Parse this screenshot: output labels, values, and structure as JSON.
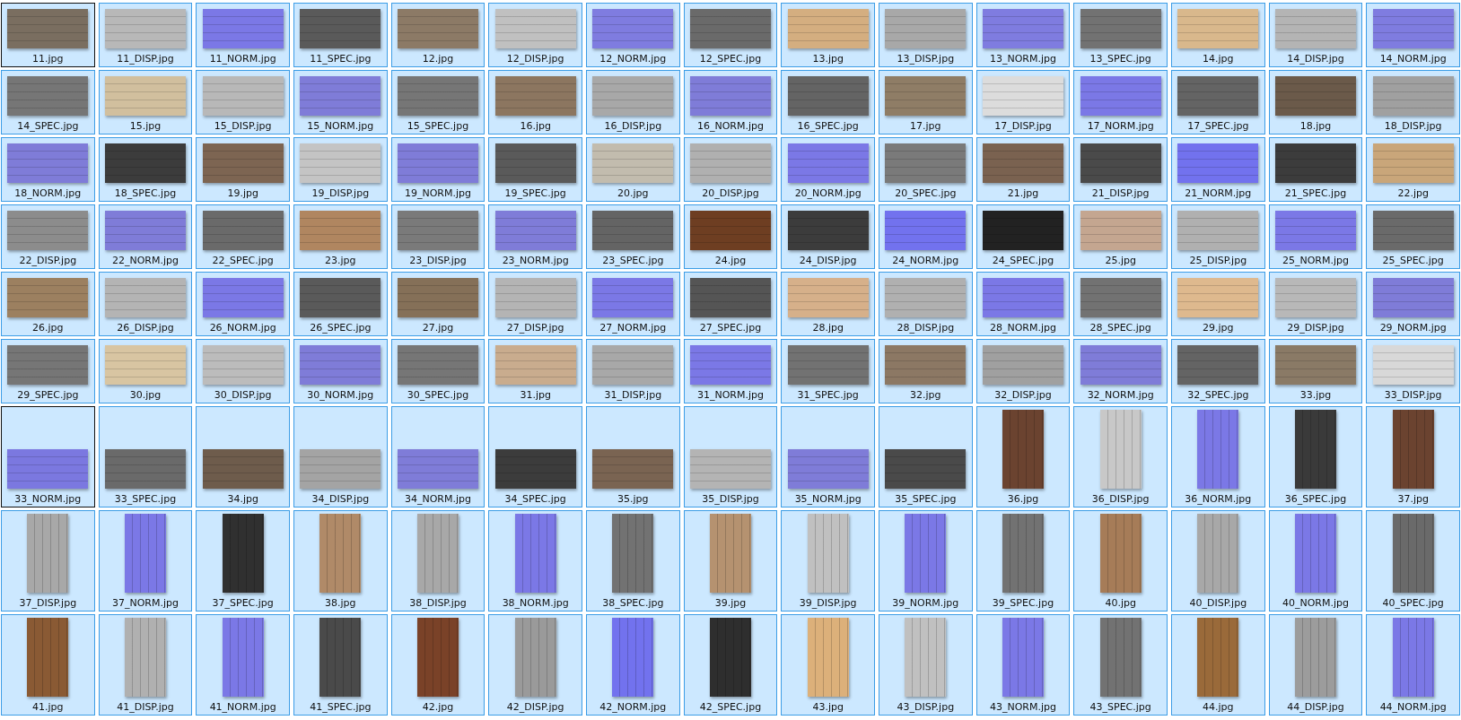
{
  "items": [
    {
      "name": "11.jpg",
      "kind": "landscape",
      "color": "#7a6e60",
      "selected": true,
      "focused": true
    },
    {
      "name": "11_DISP.jpg",
      "kind": "landscape",
      "color": "#b8b8b8",
      "selected": true,
      "focused": false
    },
    {
      "name": "11_NORM.jpg",
      "kind": "landscape",
      "color": "#7b78e6",
      "selected": true,
      "focused": false
    },
    {
      "name": "11_SPEC.jpg",
      "kind": "landscape",
      "color": "#5a5a5a",
      "selected": true,
      "focused": false
    },
    {
      "name": "12.jpg",
      "kind": "landscape",
      "color": "#8c7a66",
      "selected": true,
      "focused": false
    },
    {
      "name": "12_DISP.jpg",
      "kind": "landscape",
      "color": "#c0c0c0",
      "selected": true,
      "focused": false
    },
    {
      "name": "12_NORM.jpg",
      "kind": "landscape",
      "color": "#7f7ce0",
      "selected": true,
      "focused": false
    },
    {
      "name": "12_SPEC.jpg",
      "kind": "landscape",
      "color": "#6a6a6a",
      "selected": true,
      "focused": false
    },
    {
      "name": "13.jpg",
      "kind": "landscape",
      "color": "#d4ae80",
      "selected": true,
      "focused": false
    },
    {
      "name": "13_DISP.jpg",
      "kind": "landscape",
      "color": "#a8a8a8",
      "selected": true,
      "focused": false
    },
    {
      "name": "13_NORM.jpg",
      "kind": "landscape",
      "color": "#7f7ce0",
      "selected": true,
      "focused": false
    },
    {
      "name": "13_SPEC.jpg",
      "kind": "landscape",
      "color": "#727272",
      "selected": true,
      "focused": false
    },
    {
      "name": "14.jpg",
      "kind": "landscape",
      "color": "#d9b88c",
      "selected": true,
      "focused": false
    },
    {
      "name": "14_DISP.jpg",
      "kind": "landscape",
      "color": "#b4b4b4",
      "selected": true,
      "focused": false
    },
    {
      "name": "14_NORM.jpg",
      "kind": "landscape",
      "color": "#7f7ce0",
      "selected": true,
      "focused": false
    },
    {
      "name": "14_SPEC.jpg",
      "kind": "landscape",
      "color": "#767676",
      "selected": true,
      "focused": false
    },
    {
      "name": "15.jpg",
      "kind": "landscape",
      "color": "#d1bf9e",
      "selected": true,
      "focused": false
    },
    {
      "name": "15_DISP.jpg",
      "kind": "landscape",
      "color": "#b8b8b8",
      "selected": true,
      "focused": false
    },
    {
      "name": "15_NORM.jpg",
      "kind": "landscape",
      "color": "#7f7cd8",
      "selected": true,
      "focused": false
    },
    {
      "name": "15_SPEC.jpg",
      "kind": "landscape",
      "color": "#767676",
      "selected": true,
      "focused": false
    },
    {
      "name": "16.jpg",
      "kind": "landscape",
      "color": "#8c7660",
      "selected": true,
      "focused": false
    },
    {
      "name": "16_DISP.jpg",
      "kind": "landscape",
      "color": "#a8a8a8",
      "selected": true,
      "focused": false
    },
    {
      "name": "16_NORM.jpg",
      "kind": "landscape",
      "color": "#7f7cd8",
      "selected": true,
      "focused": false
    },
    {
      "name": "16_SPEC.jpg",
      "kind": "landscape",
      "color": "#646464",
      "selected": true,
      "focused": false
    },
    {
      "name": "17.jpg",
      "kind": "landscape",
      "color": "#8f7d66",
      "selected": true,
      "focused": false
    },
    {
      "name": "17_DISP.jpg",
      "kind": "landscape",
      "color": "#dcdcdc",
      "selected": true,
      "focused": false
    },
    {
      "name": "17_NORM.jpg",
      "kind": "landscape",
      "color": "#7b78e6",
      "selected": true,
      "focused": false
    },
    {
      "name": "17_SPEC.jpg",
      "kind": "landscape",
      "color": "#646464",
      "selected": true,
      "focused": false
    },
    {
      "name": "18.jpg",
      "kind": "landscape",
      "color": "#6b5a4a",
      "selected": true,
      "focused": false
    },
    {
      "name": "18_DISP.jpg",
      "kind": "landscape",
      "color": "#a0a0a0",
      "selected": true,
      "focused": false
    },
    {
      "name": "18_NORM.jpg",
      "kind": "landscape",
      "color": "#7f7cd8",
      "selected": true,
      "focused": false
    },
    {
      "name": "18_SPEC.jpg",
      "kind": "landscape",
      "color": "#3c3c3c",
      "selected": true,
      "focused": false
    },
    {
      "name": "19.jpg",
      "kind": "landscape",
      "color": "#7d6552",
      "selected": true,
      "focused": false
    },
    {
      "name": "19_DISP.jpg",
      "kind": "landscape",
      "color": "#c4c4c4",
      "selected": true,
      "focused": false
    },
    {
      "name": "19_NORM.jpg",
      "kind": "landscape",
      "color": "#7f7cd8",
      "selected": true,
      "focused": false
    },
    {
      "name": "19_SPEC.jpg",
      "kind": "landscape",
      "color": "#5a5a5a",
      "selected": true,
      "focused": false
    },
    {
      "name": "20.jpg",
      "kind": "landscape",
      "color": "#c2bcae",
      "selected": true,
      "focused": false
    },
    {
      "name": "20_DISP.jpg",
      "kind": "landscape",
      "color": "#b0b0b0",
      "selected": true,
      "focused": false
    },
    {
      "name": "20_NORM.jpg",
      "kind": "landscape",
      "color": "#7b78e6",
      "selected": true,
      "focused": false
    },
    {
      "name": "20_SPEC.jpg",
      "kind": "landscape",
      "color": "#7a7a7a",
      "selected": true,
      "focused": false
    },
    {
      "name": "21.jpg",
      "kind": "landscape",
      "color": "#7a6250",
      "selected": true,
      "focused": false
    },
    {
      "name": "21_DISP.jpg",
      "kind": "landscape",
      "color": "#4a4a4a",
      "selected": true,
      "focused": false
    },
    {
      "name": "21_NORM.jpg",
      "kind": "landscape",
      "color": "#7272ee",
      "selected": true,
      "focused": false
    },
    {
      "name": "21_SPEC.jpg",
      "kind": "landscape",
      "color": "#3c3c3c",
      "selected": true,
      "focused": false
    },
    {
      "name": "22.jpg",
      "kind": "landscape",
      "color": "#c9a67a",
      "selected": true,
      "focused": false
    },
    {
      "name": "22_DISP.jpg",
      "kind": "landscape",
      "color": "#8c8c8c",
      "selected": true,
      "focused": false
    },
    {
      "name": "22_NORM.jpg",
      "kind": "landscape",
      "color": "#7f7cd8",
      "selected": true,
      "focused": false
    },
    {
      "name": "22_SPEC.jpg",
      "kind": "landscape",
      "color": "#6a6a6a",
      "selected": true,
      "focused": false
    },
    {
      "name": "23.jpg",
      "kind": "landscape",
      "color": "#b08660",
      "selected": true,
      "focused": false
    },
    {
      "name": "23_DISP.jpg",
      "kind": "landscape",
      "color": "#7a7a7a",
      "selected": true,
      "focused": false
    },
    {
      "name": "23_NORM.jpg",
      "kind": "landscape",
      "color": "#7f7cd8",
      "selected": true,
      "focused": false
    },
    {
      "name": "23_SPEC.jpg",
      "kind": "landscape",
      "color": "#646464",
      "selected": true,
      "focused": false
    },
    {
      "name": "24.jpg",
      "kind": "landscape",
      "color": "#6e3e22",
      "selected": true,
      "focused": false
    },
    {
      "name": "24_DISP.jpg",
      "kind": "landscape",
      "color": "#3c3c3c",
      "selected": true,
      "focused": false
    },
    {
      "name": "24_NORM.jpg",
      "kind": "landscape",
      "color": "#7272ee",
      "selected": true,
      "focused": false
    },
    {
      "name": "24_SPEC.jpg",
      "kind": "landscape",
      "color": "#222222",
      "selected": true,
      "focused": false
    },
    {
      "name": "25.jpg",
      "kind": "landscape",
      "color": "#c4a690",
      "selected": true,
      "focused": false
    },
    {
      "name": "25_DISP.jpg",
      "kind": "landscape",
      "color": "#b0b0b0",
      "selected": true,
      "focused": false
    },
    {
      "name": "25_NORM.jpg",
      "kind": "landscape",
      "color": "#7b78e6",
      "selected": true,
      "focused": false
    },
    {
      "name": "25_SPEC.jpg",
      "kind": "landscape",
      "color": "#6a6a6a",
      "selected": true,
      "focused": false
    },
    {
      "name": "26.jpg",
      "kind": "landscape",
      "color": "#9c8060",
      "selected": true,
      "focused": false
    },
    {
      "name": "26_DISP.jpg",
      "kind": "landscape",
      "color": "#b4b4b4",
      "selected": true,
      "focused": false
    },
    {
      "name": "26_NORM.jpg",
      "kind": "landscape",
      "color": "#7b78e6",
      "selected": true,
      "focused": false
    },
    {
      "name": "26_SPEC.jpg",
      "kind": "landscape",
      "color": "#5a5a5a",
      "selected": true,
      "focused": false
    },
    {
      "name": "27.jpg",
      "kind": "landscape",
      "color": "#857058",
      "selected": true,
      "focused": false
    },
    {
      "name": "27_DISP.jpg",
      "kind": "landscape",
      "color": "#b4b4b4",
      "selected": true,
      "focused": false
    },
    {
      "name": "27_NORM.jpg",
      "kind": "landscape",
      "color": "#7b78e6",
      "selected": true,
      "focused": false
    },
    {
      "name": "27_SPEC.jpg",
      "kind": "landscape",
      "color": "#555555",
      "selected": true,
      "focused": false
    },
    {
      "name": "28.jpg",
      "kind": "landscape",
      "color": "#d6b08a",
      "selected": true,
      "focused": false
    },
    {
      "name": "28_DISP.jpg",
      "kind": "landscape",
      "color": "#b0b0b0",
      "selected": true,
      "focused": false
    },
    {
      "name": "28_NORM.jpg",
      "kind": "landscape",
      "color": "#7b78e6",
      "selected": true,
      "focused": false
    },
    {
      "name": "28_SPEC.jpg",
      "kind": "landscape",
      "color": "#727272",
      "selected": true,
      "focused": false
    },
    {
      "name": "29.jpg",
      "kind": "landscape",
      "color": "#deb98e",
      "selected": true,
      "focused": false
    },
    {
      "name": "29_DISP.jpg",
      "kind": "landscape",
      "color": "#b8b8b8",
      "selected": true,
      "focused": false
    },
    {
      "name": "29_NORM.jpg",
      "kind": "landscape",
      "color": "#7f7cd8",
      "selected": true,
      "focused": false
    },
    {
      "name": "29_SPEC.jpg",
      "kind": "landscape",
      "color": "#767676",
      "selected": true,
      "focused": false
    },
    {
      "name": "30.jpg",
      "kind": "landscape",
      "color": "#d8c5a2",
      "selected": true,
      "focused": false
    },
    {
      "name": "30_DISP.jpg",
      "kind": "landscape",
      "color": "#bcbcbc",
      "selected": true,
      "focused": false
    },
    {
      "name": "30_NORM.jpg",
      "kind": "landscape",
      "color": "#7f7cd8",
      "selected": true,
      "focused": false
    },
    {
      "name": "30_SPEC.jpg",
      "kind": "landscape",
      "color": "#767676",
      "selected": true,
      "focused": false
    },
    {
      "name": "31.jpg",
      "kind": "landscape",
      "color": "#c9ac8e",
      "selected": true,
      "focused": false
    },
    {
      "name": "31_DISP.jpg",
      "kind": "landscape",
      "color": "#a8a8a8",
      "selected": true,
      "focused": false
    },
    {
      "name": "31_NORM.jpg",
      "kind": "landscape",
      "color": "#7b78e6",
      "selected": true,
      "focused": false
    },
    {
      "name": "31_SPEC.jpg",
      "kind": "landscape",
      "color": "#727272",
      "selected": true,
      "focused": false
    },
    {
      "name": "32.jpg",
      "kind": "landscape",
      "color": "#8c7864",
      "selected": true,
      "focused": false
    },
    {
      "name": "32_DISP.jpg",
      "kind": "landscape",
      "color": "#a0a0a0",
      "selected": true,
      "focused": false
    },
    {
      "name": "32_NORM.jpg",
      "kind": "landscape",
      "color": "#7f7cd8",
      "selected": true,
      "focused": false
    },
    {
      "name": "32_SPEC.jpg",
      "kind": "landscape",
      "color": "#646464",
      "selected": true,
      "focused": false
    },
    {
      "name": "33.jpg",
      "kind": "landscape",
      "color": "#8a7a66",
      "selected": true,
      "focused": false
    },
    {
      "name": "33_DISP.jpg",
      "kind": "landscape",
      "color": "#d8d8d8",
      "selected": true,
      "focused": false
    },
    {
      "name": "33_NORM.jpg",
      "kind": "landscape",
      "color": "#7b78e0",
      "selected": true,
      "focused": true
    },
    {
      "name": "33_SPEC.jpg",
      "kind": "landscape",
      "color": "#6a6a6a",
      "selected": true,
      "focused": false
    },
    {
      "name": "34.jpg",
      "kind": "landscape",
      "color": "#6e5c4c",
      "selected": true,
      "focused": false
    },
    {
      "name": "34_DISP.jpg",
      "kind": "landscape",
      "color": "#a4a4a4",
      "selected": true,
      "focused": false
    },
    {
      "name": "34_NORM.jpg",
      "kind": "landscape",
      "color": "#7f7cd8",
      "selected": true,
      "focused": false
    },
    {
      "name": "34_SPEC.jpg",
      "kind": "landscape",
      "color": "#3c3c3c",
      "selected": true,
      "focused": false
    },
    {
      "name": "35.jpg",
      "kind": "landscape",
      "color": "#7a6452",
      "selected": true,
      "focused": false
    },
    {
      "name": "35_DISP.jpg",
      "kind": "landscape",
      "color": "#b4b4b4",
      "selected": true,
      "focused": false
    },
    {
      "name": "35_NORM.jpg",
      "kind": "landscape",
      "color": "#7f7cd8",
      "selected": true,
      "focused": false
    },
    {
      "name": "35_SPEC.jpg",
      "kind": "landscape",
      "color": "#4a4a4a",
      "selected": true,
      "focused": false
    },
    {
      "name": "36.jpg",
      "kind": "portrait",
      "color": "#6b4330",
      "selected": true,
      "focused": false
    },
    {
      "name": "36_DISP.jpg",
      "kind": "portrait",
      "color": "#c8c8c8",
      "selected": true,
      "focused": false
    },
    {
      "name": "36_NORM.jpg",
      "kind": "portrait",
      "color": "#7b78e6",
      "selected": true,
      "focused": false
    },
    {
      "name": "36_SPEC.jpg",
      "kind": "portrait",
      "color": "#3a3a3a",
      "selected": true,
      "focused": false
    },
    {
      "name": "37.jpg",
      "kind": "portrait",
      "color": "#6b4330",
      "selected": true,
      "focused": false
    },
    {
      "name": "37_DISP.jpg",
      "kind": "portrait",
      "color": "#a8a8a8",
      "selected": true,
      "focused": false
    },
    {
      "name": "37_NORM.jpg",
      "kind": "portrait",
      "color": "#7b78e6",
      "selected": true,
      "focused": false
    },
    {
      "name": "37_SPEC.jpg",
      "kind": "portrait",
      "color": "#303030",
      "selected": true,
      "focused": false
    },
    {
      "name": "38.jpg",
      "kind": "portrait",
      "color": "#b08a68",
      "selected": true,
      "focused": false
    },
    {
      "name": "38_DISP.jpg",
      "kind": "portrait",
      "color": "#a8a8a8",
      "selected": true,
      "focused": false
    },
    {
      "name": "38_NORM.jpg",
      "kind": "portrait",
      "color": "#7b78e6",
      "selected": true,
      "focused": false
    },
    {
      "name": "38_SPEC.jpg",
      "kind": "portrait",
      "color": "#727272",
      "selected": true,
      "focused": false
    },
    {
      "name": "39.jpg",
      "kind": "portrait",
      "color": "#b59270",
      "selected": true,
      "focused": false
    },
    {
      "name": "39_DISP.jpg",
      "kind": "portrait",
      "color": "#c0c0c0",
      "selected": true,
      "focused": false
    },
    {
      "name": "39_NORM.jpg",
      "kind": "portrait",
      "color": "#7b78e6",
      "selected": true,
      "focused": false
    },
    {
      "name": "39_SPEC.jpg",
      "kind": "portrait",
      "color": "#727272",
      "selected": true,
      "focused": false
    },
    {
      "name": "40.jpg",
      "kind": "portrait",
      "color": "#a67c58",
      "selected": true,
      "focused": false
    },
    {
      "name": "40_DISP.jpg",
      "kind": "portrait",
      "color": "#a8a8a8",
      "selected": true,
      "focused": false
    },
    {
      "name": "40_NORM.jpg",
      "kind": "portrait",
      "color": "#7b78e6",
      "selected": true,
      "focused": false
    },
    {
      "name": "40_SPEC.jpg",
      "kind": "portrait",
      "color": "#6a6a6a",
      "selected": true,
      "focused": false
    },
    {
      "name": "41.jpg",
      "kind": "portrait",
      "color": "#8a5a34",
      "selected": true,
      "focused": false
    },
    {
      "name": "41_DISP.jpg",
      "kind": "portrait",
      "color": "#b0b0b0",
      "selected": true,
      "focused": false
    },
    {
      "name": "41_NORM.jpg",
      "kind": "portrait",
      "color": "#7b78e6",
      "selected": true,
      "focused": false
    },
    {
      "name": "41_SPEC.jpg",
      "kind": "portrait",
      "color": "#4a4a4a",
      "selected": true,
      "focused": false
    },
    {
      "name": "42.jpg",
      "kind": "portrait",
      "color": "#7a4228",
      "selected": true,
      "focused": false
    },
    {
      "name": "42_DISP.jpg",
      "kind": "portrait",
      "color": "#9a9a9a",
      "selected": true,
      "focused": false
    },
    {
      "name": "42_NORM.jpg",
      "kind": "portrait",
      "color": "#7272ee",
      "selected": true,
      "focused": false
    },
    {
      "name": "42_SPEC.jpg",
      "kind": "portrait",
      "color": "#2e2e2e",
      "selected": true,
      "focused": false
    },
    {
      "name": "43.jpg",
      "kind": "portrait",
      "color": "#dcb07a",
      "selected": true,
      "focused": false
    },
    {
      "name": "43_DISP.jpg",
      "kind": "portrait",
      "color": "#c0c0c0",
      "selected": true,
      "focused": false
    },
    {
      "name": "43_NORM.jpg",
      "kind": "portrait",
      "color": "#7b78e6",
      "selected": true,
      "focused": false
    },
    {
      "name": "43_SPEC.jpg",
      "kind": "portrait",
      "color": "#727272",
      "selected": true,
      "focused": false
    },
    {
      "name": "44.jpg",
      "kind": "portrait",
      "color": "#9a6a3a",
      "selected": true,
      "focused": false
    },
    {
      "name": "44_DISP.jpg",
      "kind": "portrait",
      "color": "#9c9c9c",
      "selected": true,
      "focused": false
    },
    {
      "name": "44_NORM.jpg",
      "kind": "portrait",
      "color": "#7b78e6",
      "selected": true,
      "focused": false
    }
  ]
}
